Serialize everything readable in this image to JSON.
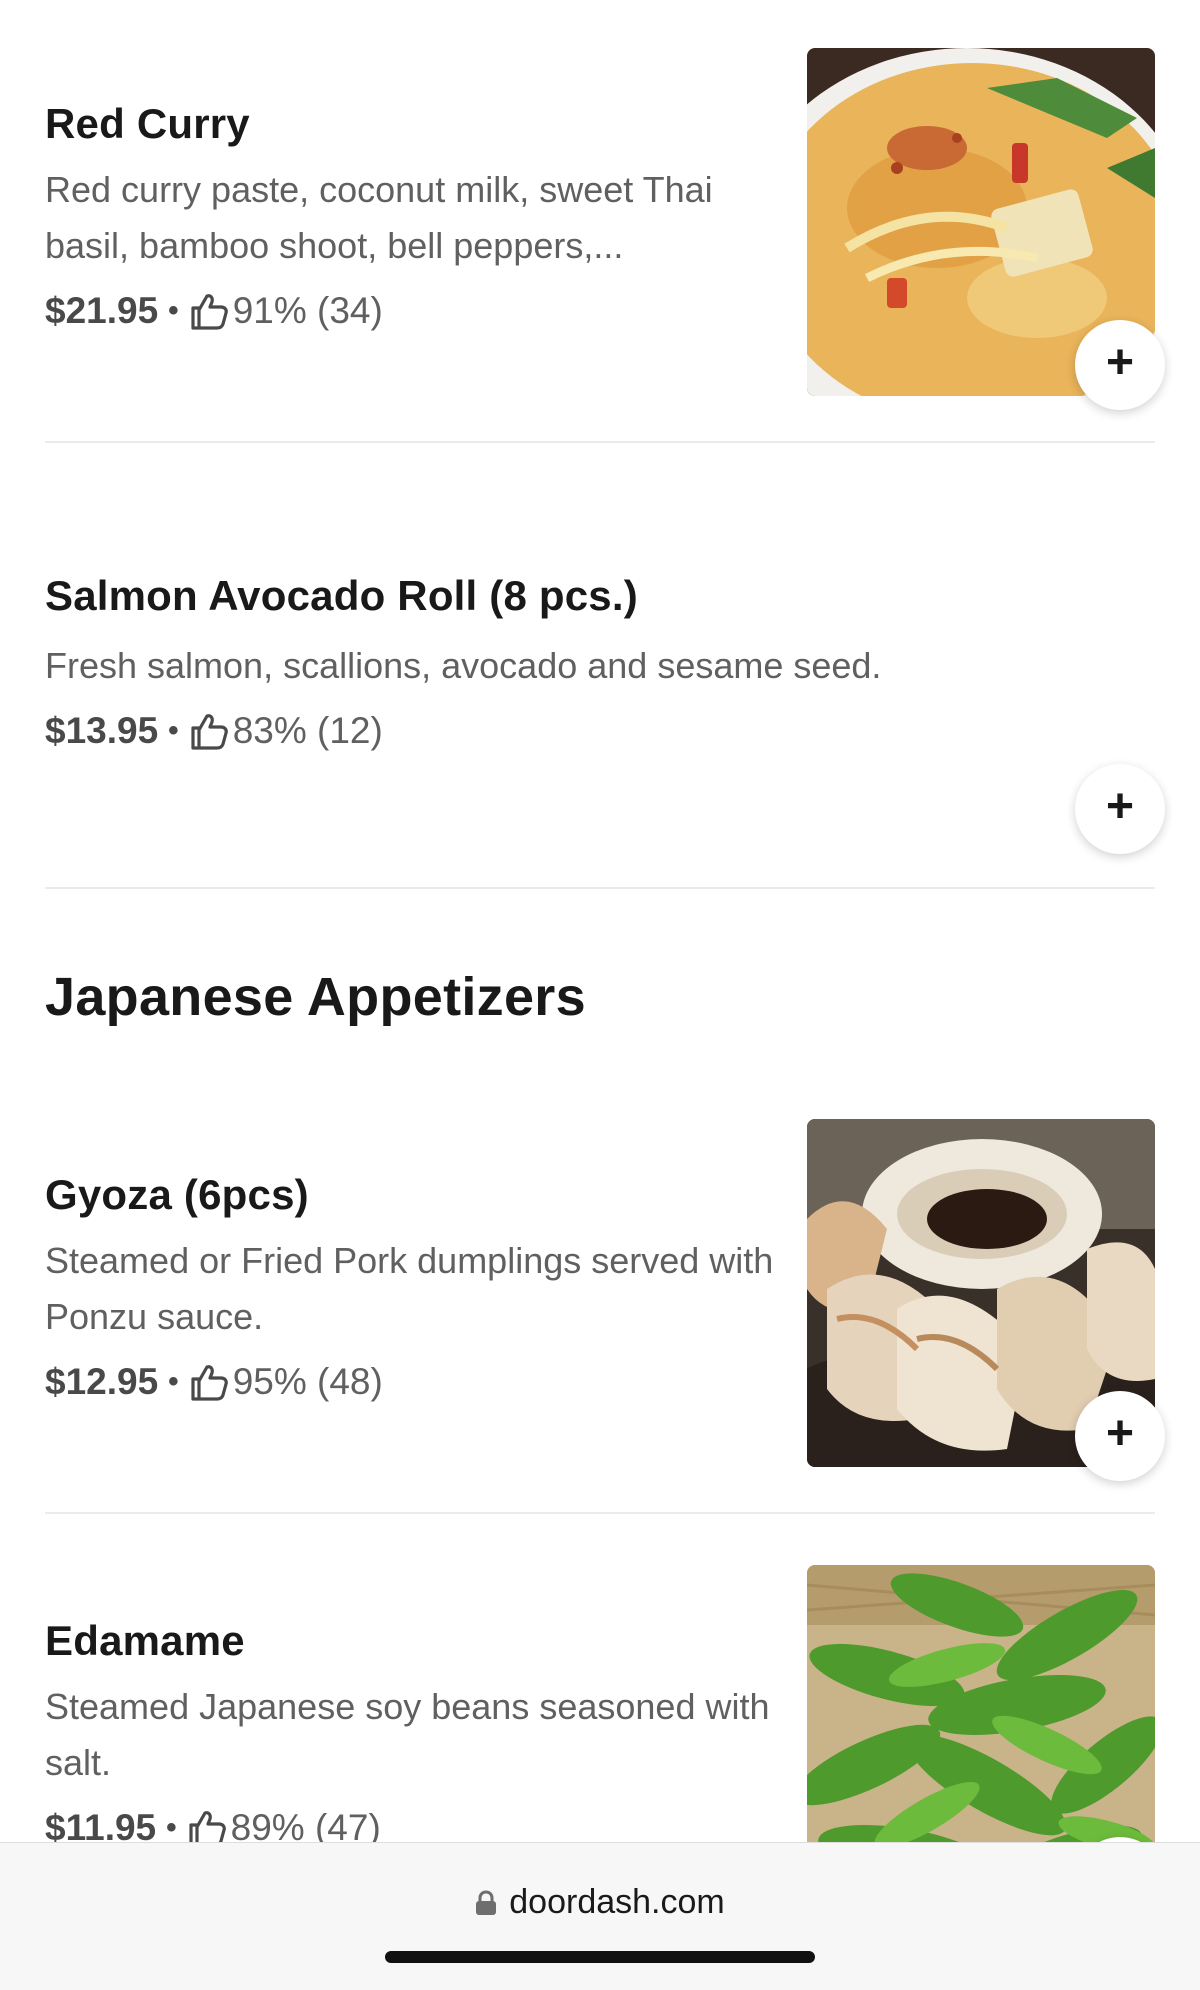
{
  "menu": {
    "items": [
      {
        "name": "Red Curry",
        "description": "Red curry paste, coconut milk, sweet Thai basil, bamboo shoot, bell peppers,...",
        "price": "$21.95",
        "rating": "91% (34)",
        "image": "red-curry-photo"
      },
      {
        "name": "Salmon Avocado Roll (8 pcs.)",
        "description": "Fresh salmon, scallions, avocado and sesame seed.",
        "price": "$13.95",
        "rating": "83% (12)"
      },
      {
        "name": "Gyoza (6pcs)",
        "description": "Steamed or Fried Pork dumplings served with Ponzu sauce.",
        "price": "$12.95",
        "rating": "95% (48)",
        "image": "gyoza-photo"
      },
      {
        "name": "Edamame",
        "description": "Steamed Japanese soy beans seasoned with salt.",
        "price": "$11.95",
        "rating": "89% (47)",
        "image": "edamame-photo"
      }
    ],
    "section_title": "Japanese Appetizers",
    "separator": "•",
    "add_label": "+"
  },
  "browser": {
    "url": "doordash.com"
  },
  "icons": {
    "rating": "thumbs-up-icon",
    "add": "plus-icon",
    "secure": "lock-icon"
  },
  "colors": {
    "text_primary": "#191919",
    "text_secondary": "#606060",
    "divider": "#ebebeb"
  }
}
